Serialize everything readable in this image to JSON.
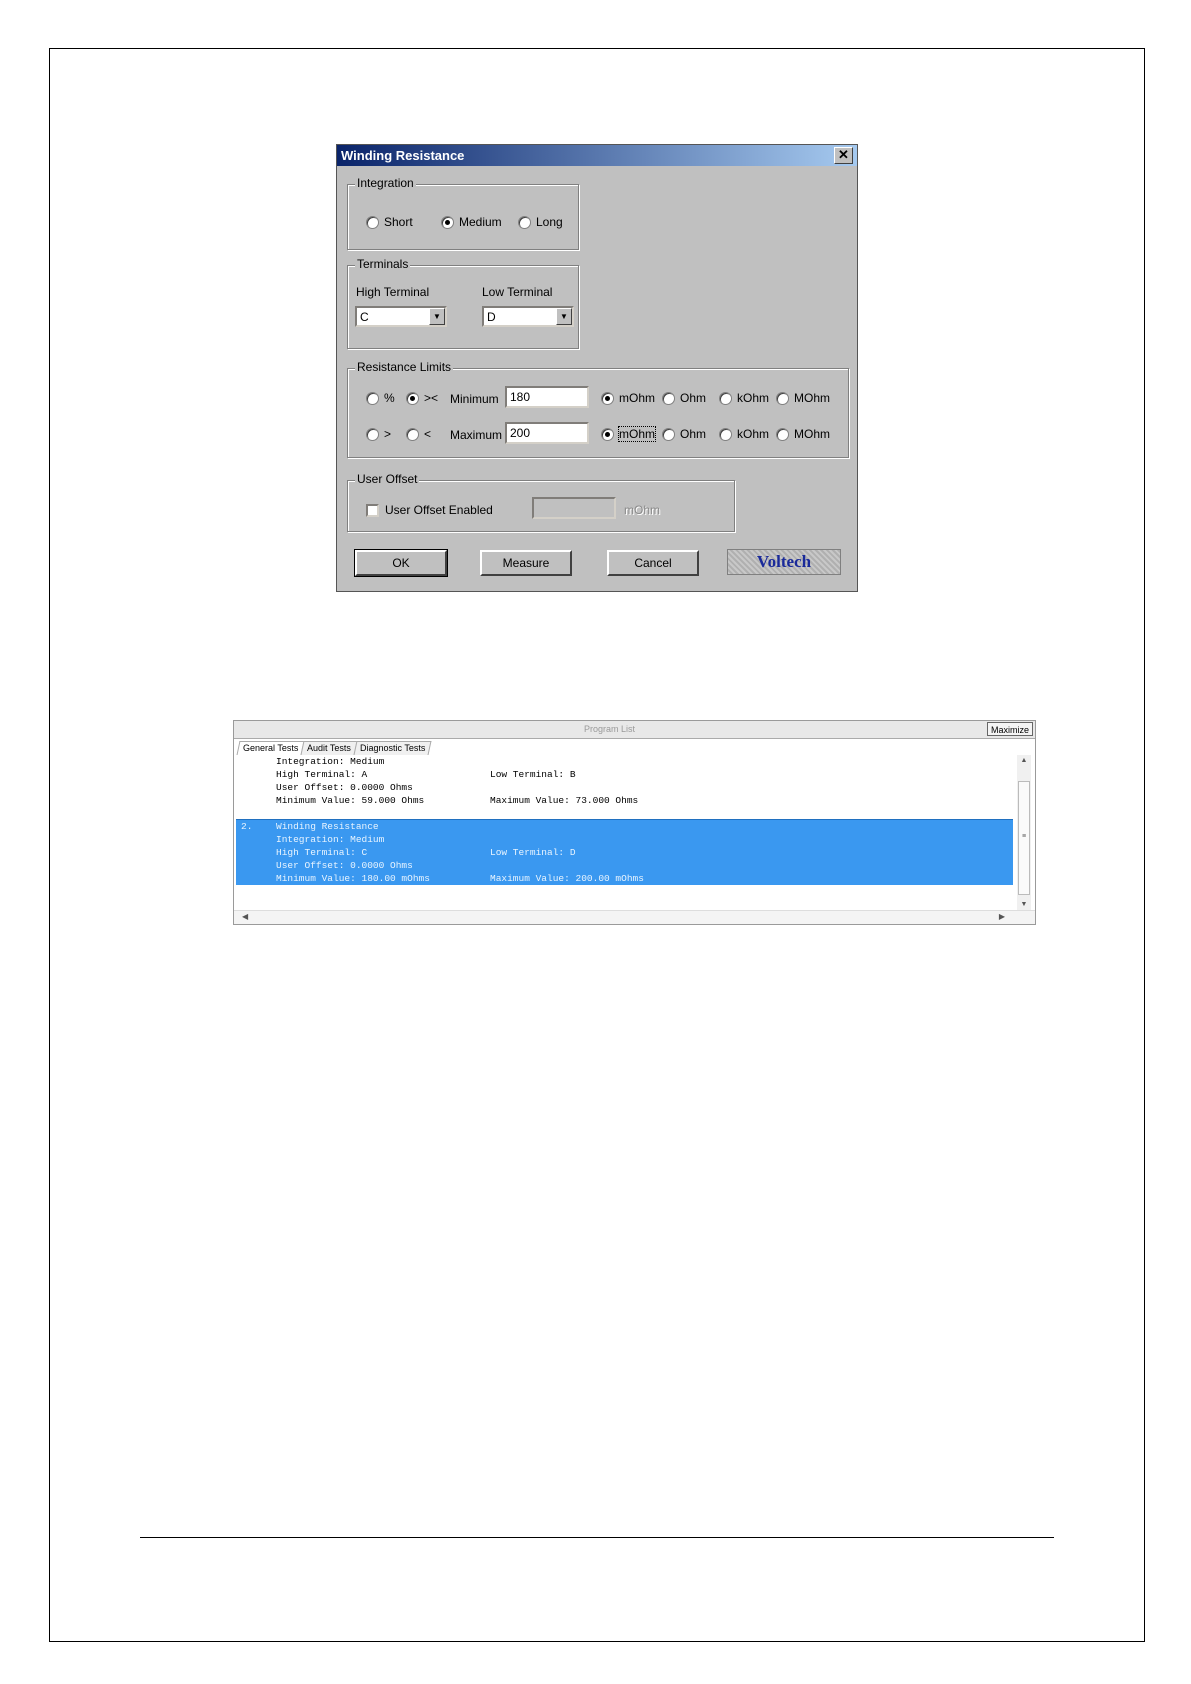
{
  "dialog": {
    "title": "Winding Resistance",
    "close_glyph": "✕",
    "integration": {
      "label": "Integration",
      "options": [
        "Short",
        "Medium",
        "Long"
      ],
      "selected": "Medium"
    },
    "terminals": {
      "label": "Terminals",
      "high_label": "High Terminal",
      "low_label": "Low Terminal",
      "high_value": "C",
      "low_value": "D"
    },
    "limits": {
      "label": "Resistance Limits",
      "mode_row1": [
        "%",
        "><"
      ],
      "mode_row2": [
        ">",
        "<"
      ],
      "mode_selected": "><",
      "minimum_label": "Minimum",
      "maximum_label": "Maximum",
      "minimum_value": "180",
      "maximum_value": "200",
      "units": [
        "mOhm",
        "Ohm",
        "kOhm",
        "MOhm"
      ],
      "min_unit_selected": "mOhm",
      "max_unit_selected": "mOhm"
    },
    "user_offset": {
      "label": "User Offset",
      "checkbox_label": "User Offset Enabled",
      "enabled": false,
      "unit": "mOhm",
      "value": ""
    },
    "buttons": {
      "ok": "OK",
      "measure": "Measure",
      "cancel": "Cancel"
    },
    "logo_text": "Voltech"
  },
  "program_list": {
    "title": "Program List",
    "maximize_label": "Maximize",
    "tabs": [
      "General Tests",
      "Audit Tests",
      "Diagnostic Tests"
    ],
    "active_tab": "General Tests",
    "entries": [
      {
        "number": "",
        "selected": false,
        "lines": [
          [
            "Integration:  Medium",
            ""
          ],
          [
            "High Terminal: A",
            "Low Terminal: B"
          ],
          [
            "User Offset: 0.0000 Ohms",
            ""
          ],
          [
            "Minimum Value: 59.000 Ohms",
            "Maximum Value: 73.000 Ohms"
          ]
        ]
      },
      {
        "number": "2.",
        "selected": true,
        "lines": [
          [
            "Winding Resistance",
            ""
          ],
          [
            "Integration:  Medium",
            ""
          ],
          [
            "High Terminal: C",
            "Low Terminal: D"
          ],
          [
            "User Offset: 0.0000 Ohms",
            ""
          ],
          [
            "Minimum Value: 180.00 mOhms",
            "Maximum Value: 200.00 mOhms"
          ]
        ]
      }
    ]
  }
}
